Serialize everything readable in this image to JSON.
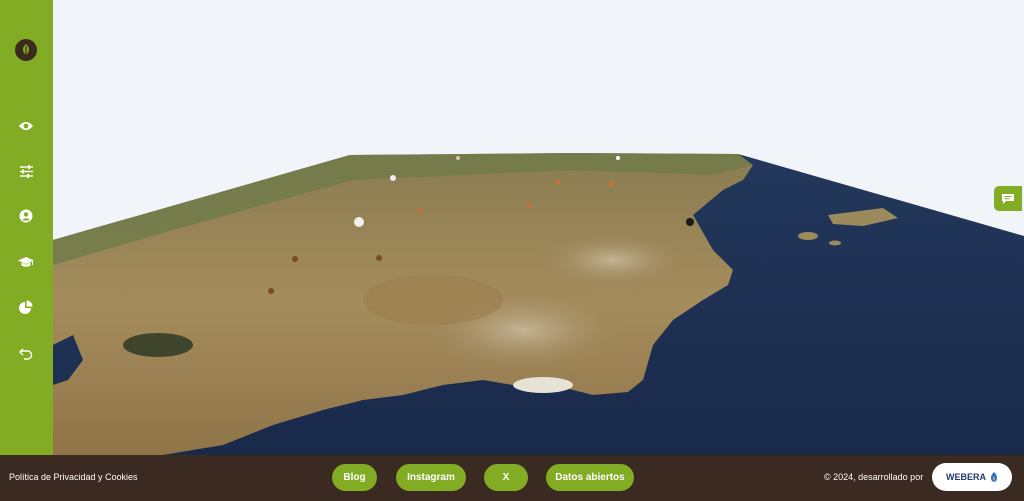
{
  "sidebar": {
    "logo_icon": "tree-leaf-logo",
    "items": [
      {
        "icon": "eye-icon"
      },
      {
        "icon": "sliders-icon"
      },
      {
        "icon": "user-circle-icon"
      },
      {
        "icon": "graduation-cap-icon"
      },
      {
        "icon": "pie-chart-icon"
      },
      {
        "icon": "undo-icon"
      }
    ]
  },
  "map": {
    "view": "3d-terrain",
    "chat_icon": "chat-bubble-icon"
  },
  "footer": {
    "privacy_label": "Política de Privacidad y Cookies",
    "links": [
      {
        "label": "Blog"
      },
      {
        "label": "Instagram"
      },
      {
        "label": "X"
      },
      {
        "label": "Datos abiertos"
      }
    ],
    "copyright": "© 2024, desarrollado por",
    "brand": "WEBERA"
  },
  "colors": {
    "accent": "#82ac23",
    "footer_bg": "#3a2a22",
    "sky": "#f1f4f8",
    "sea": "#1d3153"
  }
}
